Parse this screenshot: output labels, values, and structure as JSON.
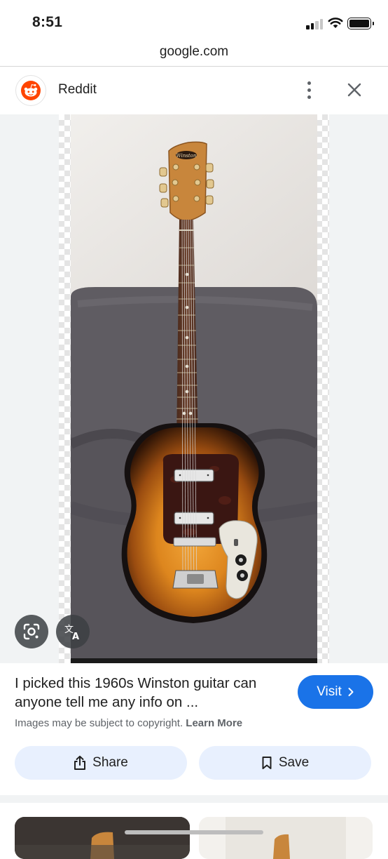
{
  "status_bar": {
    "time": "8:51"
  },
  "url_bar": {
    "domain": "google.com"
  },
  "source": {
    "name": "Reddit",
    "logo_icon": "reddit-icon"
  },
  "header_actions": {
    "more_icon": "more-vert-icon",
    "close_icon": "close-icon"
  },
  "image_viewer": {
    "image_subject": "guitar",
    "guitar_brand": "Winston",
    "lens_icon": "google-lens-icon",
    "translate_icon": "translate-icon"
  },
  "result": {
    "title": "I picked this 1960s Winston guitar can anyone tell me any info on ...",
    "visit_label": "Visit",
    "copyright_text": "Images may be subject to copyright.",
    "learn_more_label": "Learn More"
  },
  "actions": {
    "share_label": "Share",
    "save_label": "Save"
  },
  "colors": {
    "accent": "#1a73e8",
    "action_bg": "#e8f0fe",
    "reddit": "#ff4500"
  }
}
